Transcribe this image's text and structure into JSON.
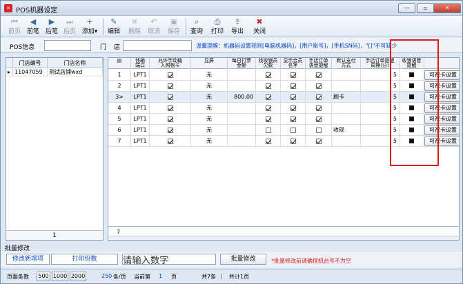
{
  "window": {
    "title": "POS机器设定"
  },
  "toolbar": {
    "items": [
      {
        "label": "前页",
        "icon": "first-page-icon",
        "disabled": true
      },
      {
        "label": "前笔",
        "icon": "prev-record-icon",
        "disabled": false
      },
      {
        "label": "后笔",
        "icon": "next-record-icon",
        "disabled": false
      },
      {
        "label": "后页",
        "icon": "last-page-icon",
        "disabled": true
      },
      {
        "label": "添加",
        "icon": "add-record-icon",
        "disabled": false
      },
      {
        "label": "编辑",
        "icon": "edit-icon",
        "disabled": false
      },
      {
        "label": "删除",
        "icon": "delete-icon",
        "disabled": true
      },
      {
        "label": "取消",
        "icon": "undo-icon",
        "disabled": true
      },
      {
        "label": "保存",
        "icon": "save-icon",
        "disabled": true
      },
      {
        "label": "查询",
        "icon": "query-icon",
        "disabled": false
      },
      {
        "label": "打印",
        "icon": "print-icon",
        "disabled": false
      },
      {
        "label": "导出",
        "icon": "export-icon",
        "disabled": false
      },
      {
        "label": "关闭",
        "icon": "close-icon",
        "disabled": false
      }
    ]
  },
  "filters": {
    "pos_label": "POS信息",
    "store_label": "门",
    "store_label_2": "店",
    "hint": "温馨提醒：机器码设置规则[电脑机器码]，[用户账号]，[手机SN码]，\"[]\"不可缺少"
  },
  "stores": {
    "headers": [
      "门店编号",
      "门店名称"
    ],
    "rows": [
      [
        "11047059",
        "测试店铺wxd"
      ]
    ],
    "footer": "1"
  },
  "grid": {
    "headers": [
      "",
      "钱箱\n端口",
      "允许手动输\n入购物卡",
      "显屏",
      "每日打票\n金额",
      "找收银员\n欠款",
      "显示会员\n名字",
      "手店订单\n语音提醒",
      "默认支付\n方式",
      "手店订单提醒\n周期(分)",
      "收银语音\n提醒",
      ""
    ],
    "rows": [
      {
        "num": "1",
        "port": "LPT1",
        "manual": true,
        "screen": "无",
        "amount": "",
        "cashier": true,
        "member": true,
        "voice": true,
        "pay": "",
        "period": "5",
        "btn": "可视卡设置"
      },
      {
        "num": "2",
        "port": "LPT1",
        "manual": true,
        "screen": "无",
        "amount": "",
        "cashier": true,
        "member": true,
        "voice": true,
        "pay": "",
        "period": "5",
        "btn": "可视卡设置"
      },
      {
        "num": "3",
        "port": "LPT1",
        "manual": true,
        "screen": "无",
        "amount": "800.00",
        "cashier": true,
        "member": true,
        "voice": true,
        "pay": "刷卡",
        "period": "5",
        "btn": "可视卡设置"
      },
      {
        "num": "4",
        "port": "LPT1",
        "manual": true,
        "screen": "无",
        "amount": "",
        "cashier": true,
        "member": true,
        "voice": true,
        "pay": "",
        "period": "5",
        "btn": "可视卡设置"
      },
      {
        "num": "5",
        "port": "LPT1",
        "manual": true,
        "screen": "无",
        "amount": "",
        "cashier": true,
        "member": true,
        "voice": true,
        "pay": "",
        "period": "5",
        "btn": "可视卡设置"
      },
      {
        "num": "6",
        "port": "LPT1",
        "manual": true,
        "screen": "无",
        "amount": "",
        "cashier": false,
        "member": false,
        "voice": false,
        "pay": "收现",
        "period": "5",
        "btn": "可视卡设置"
      },
      {
        "num": "7",
        "port": "LPT1",
        "manual": true,
        "screen": "无",
        "amount": "",
        "cashier": true,
        "member": true,
        "voice": true,
        "pay": "",
        "period": "5",
        "btn": "可视卡设置"
      }
    ],
    "selected_index": 2,
    "count": "7"
  },
  "bulk": {
    "title": "批量修改",
    "modify_new_label": "修改新增项",
    "print_count_label": "打印份数",
    "input_value": "请输入数字",
    "submit_label": "批量修改",
    "warning": "*批量修改前请确保机台号不为空"
  },
  "pager": {
    "per_page_label": "页面条数",
    "sizes": [
      "500",
      "1000",
      "2000"
    ],
    "per_page": "250",
    "unit": "条/页",
    "current_prefix": "当前第",
    "current": "1",
    "page_unit": "页",
    "total_records": "共7条",
    "total_pages": "共计1页"
  },
  "colors": {
    "accent": "#1847d7",
    "warning": "#e01b1b",
    "highlight": "#e01a1a"
  }
}
